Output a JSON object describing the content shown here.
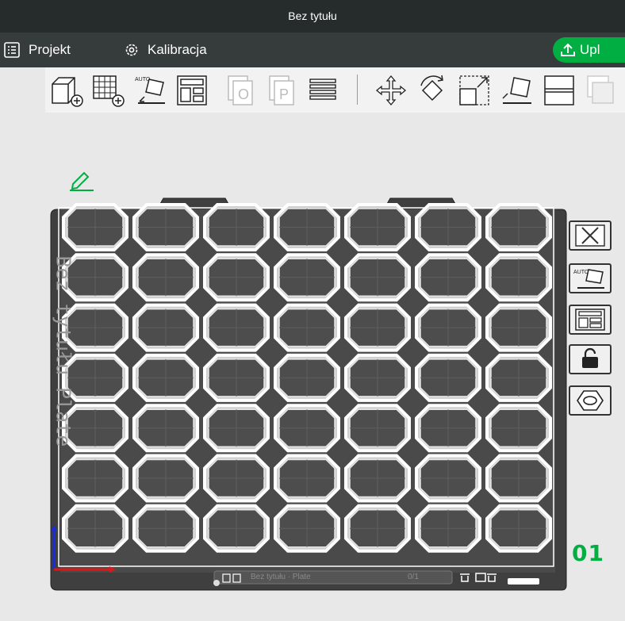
{
  "window": {
    "title": "Bez tytułu"
  },
  "menu": {
    "project_label": "Projekt",
    "calibration_label": "Kalibracja",
    "upload_label": "Upl"
  },
  "toolbar": {
    "icons": [
      "add-cube-icon",
      "add-plate-icon",
      "auto-orient-icon",
      "arrange-icon",
      "split-objects-icon",
      "split-parts-icon",
      "layers-icon",
      "move-icon",
      "rotate-icon",
      "scale-icon",
      "lay-on-face-icon",
      "cut-icon",
      "assembly-icon"
    ]
  },
  "plate": {
    "number": "01",
    "label": "Bez tytułu Plate",
    "hover_label": "Bez tytułu · Plate",
    "hover_stat": "0/1",
    "grid_rows": 7,
    "grid_cols": 7
  },
  "side_buttons": [
    "close-icon",
    "auto-orient-icon",
    "arrange-icon",
    "lock-icon",
    "settings-icon"
  ],
  "colors": {
    "accent": "#00ae42",
    "titlebar": "#262b2c",
    "menubar": "#363b3c",
    "bed": "#4a4a4a",
    "object_edge": "#ffffff"
  }
}
